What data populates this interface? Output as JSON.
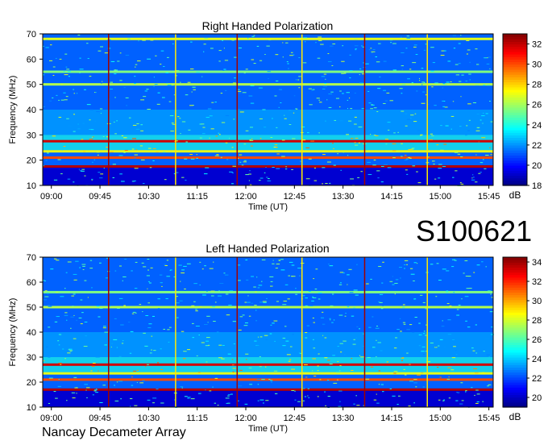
{
  "page": {
    "observation_id": "S100621",
    "instrument": "Nancay Decameter Array"
  },
  "chart_data": [
    {
      "type": "heatmap",
      "title": "Right Handed Polarization",
      "xlabel": "Time (UT)",
      "ylabel": "Frequency (MHz)",
      "x_ticks": [
        "09:00",
        "09:45",
        "10:30",
        "11:15",
        "12:00",
        "12:45",
        "13:30",
        "14:15",
        "15:00",
        "15:45"
      ],
      "y_ticks": [
        10,
        20,
        30,
        40,
        50,
        60,
        70
      ],
      "ylim": [
        10,
        70
      ],
      "colorbar": {
        "label": "dB",
        "ticks": [
          18,
          20,
          22,
          24,
          26,
          28,
          30,
          32
        ],
        "range": [
          18,
          33
        ]
      },
      "vertical_markers": [
        "09:53",
        "10:55",
        "11:52",
        "12:52",
        "13:50",
        "14:48"
      ],
      "bright_bands_mhz": [
        17.5,
        21,
        23.5,
        27.5,
        50,
        55,
        68
      ]
    },
    {
      "type": "heatmap",
      "title": "Left Handed Polarization",
      "xlabel": "Time (UT)",
      "ylabel": "Frequency (MHz)",
      "x_ticks": [
        "09:00",
        "09:45",
        "10:30",
        "11:15",
        "12:00",
        "12:45",
        "13:30",
        "14:15",
        "15:00",
        "15:45"
      ],
      "y_ticks": [
        10,
        20,
        30,
        40,
        50,
        60,
        70
      ],
      "ylim": [
        10,
        70
      ],
      "colorbar": {
        "label": "dB",
        "ticks": [
          20,
          22,
          24,
          26,
          28,
          30,
          32,
          34
        ],
        "range": [
          19,
          34.5
        ]
      },
      "vertical_markers": [
        "09:53",
        "10:55",
        "11:52",
        "12:52",
        "13:50",
        "14:48"
      ],
      "bright_bands_mhz": [
        17,
        21,
        23.5,
        27,
        50,
        56
      ]
    }
  ]
}
